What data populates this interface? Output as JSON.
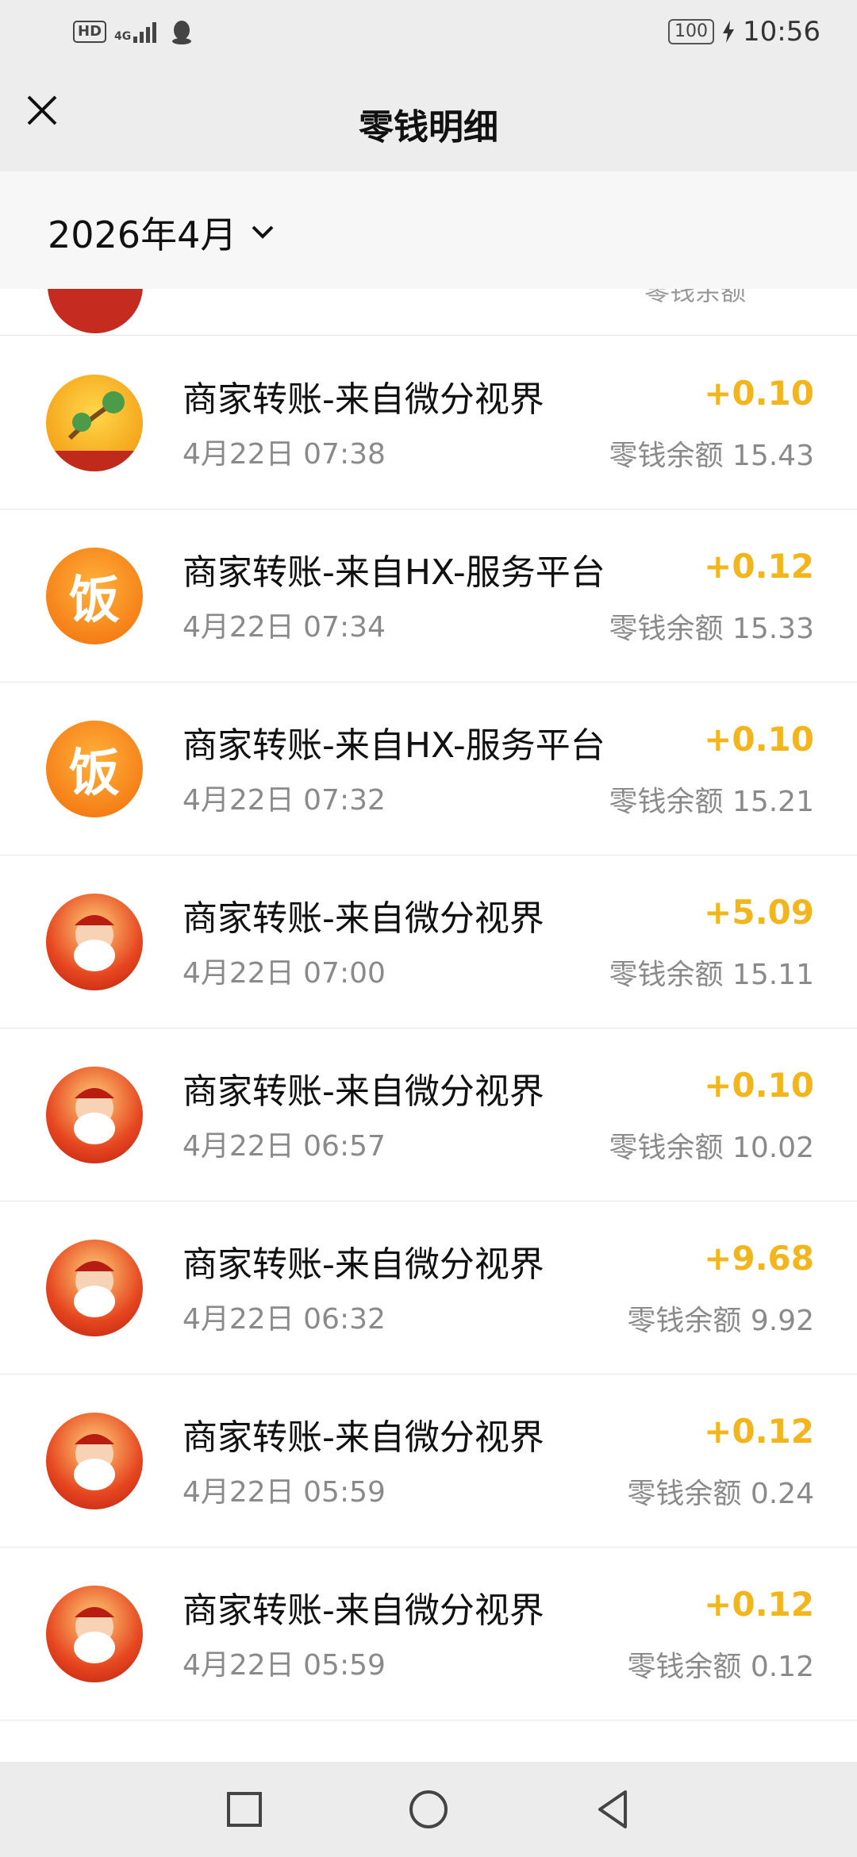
{
  "statusbar": {
    "hd": "HD",
    "network": "4G",
    "battery": "100",
    "time": "10:56"
  },
  "nav": {
    "title": "零钱明细"
  },
  "filter": {
    "label": "2026年4月"
  },
  "partial_row": {
    "text": "零钱余额"
  },
  "transactions": [
    {
      "title": "商家转账-来自微分视界",
      "time": "4月22日 07:38",
      "amount": "+0.10",
      "balance": "零钱余额 15.43",
      "avatar": "jade-avatar-icon"
    },
    {
      "title": "商家转账-来自HX-服务平台",
      "time": "4月22日 07:34",
      "amount": "+0.12",
      "balance": "零钱余额 15.33",
      "avatar": "fan-avatar-icon",
      "avatar_char": "饭"
    },
    {
      "title": "商家转账-来自HX-服务平台",
      "time": "4月22日 07:32",
      "amount": "+0.10",
      "balance": "零钱余额 15.21",
      "avatar": "fan-avatar-icon",
      "avatar_char": "饭"
    },
    {
      "title": "商家转账-来自微分视界",
      "time": "4月22日 07:00",
      "amount": "+5.09",
      "balance": "零钱余额 15.11",
      "avatar": "god-of-wealth-avatar-icon"
    },
    {
      "title": "商家转账-来自微分视界",
      "time": "4月22日 06:57",
      "amount": "+0.10",
      "balance": "零钱余额 10.02",
      "avatar": "god-of-wealth-avatar-icon"
    },
    {
      "title": "商家转账-来自微分视界",
      "time": "4月22日 06:32",
      "amount": "+9.68",
      "balance": "零钱余额 9.92",
      "avatar": "god-of-wealth-avatar-icon"
    },
    {
      "title": "商家转账-来自微分视界",
      "time": "4月22日 05:59",
      "amount": "+0.12",
      "balance": "零钱余额 0.24",
      "avatar": "god-of-wealth-avatar-icon"
    },
    {
      "title": "商家转账-来自微分视界",
      "time": "4月22日 05:59",
      "amount": "+0.12",
      "balance": "零钱余额 0.12",
      "avatar": "god-of-wealth-avatar-icon"
    }
  ],
  "colors": {
    "amount": "#f2b51c",
    "background": "#ededed"
  }
}
